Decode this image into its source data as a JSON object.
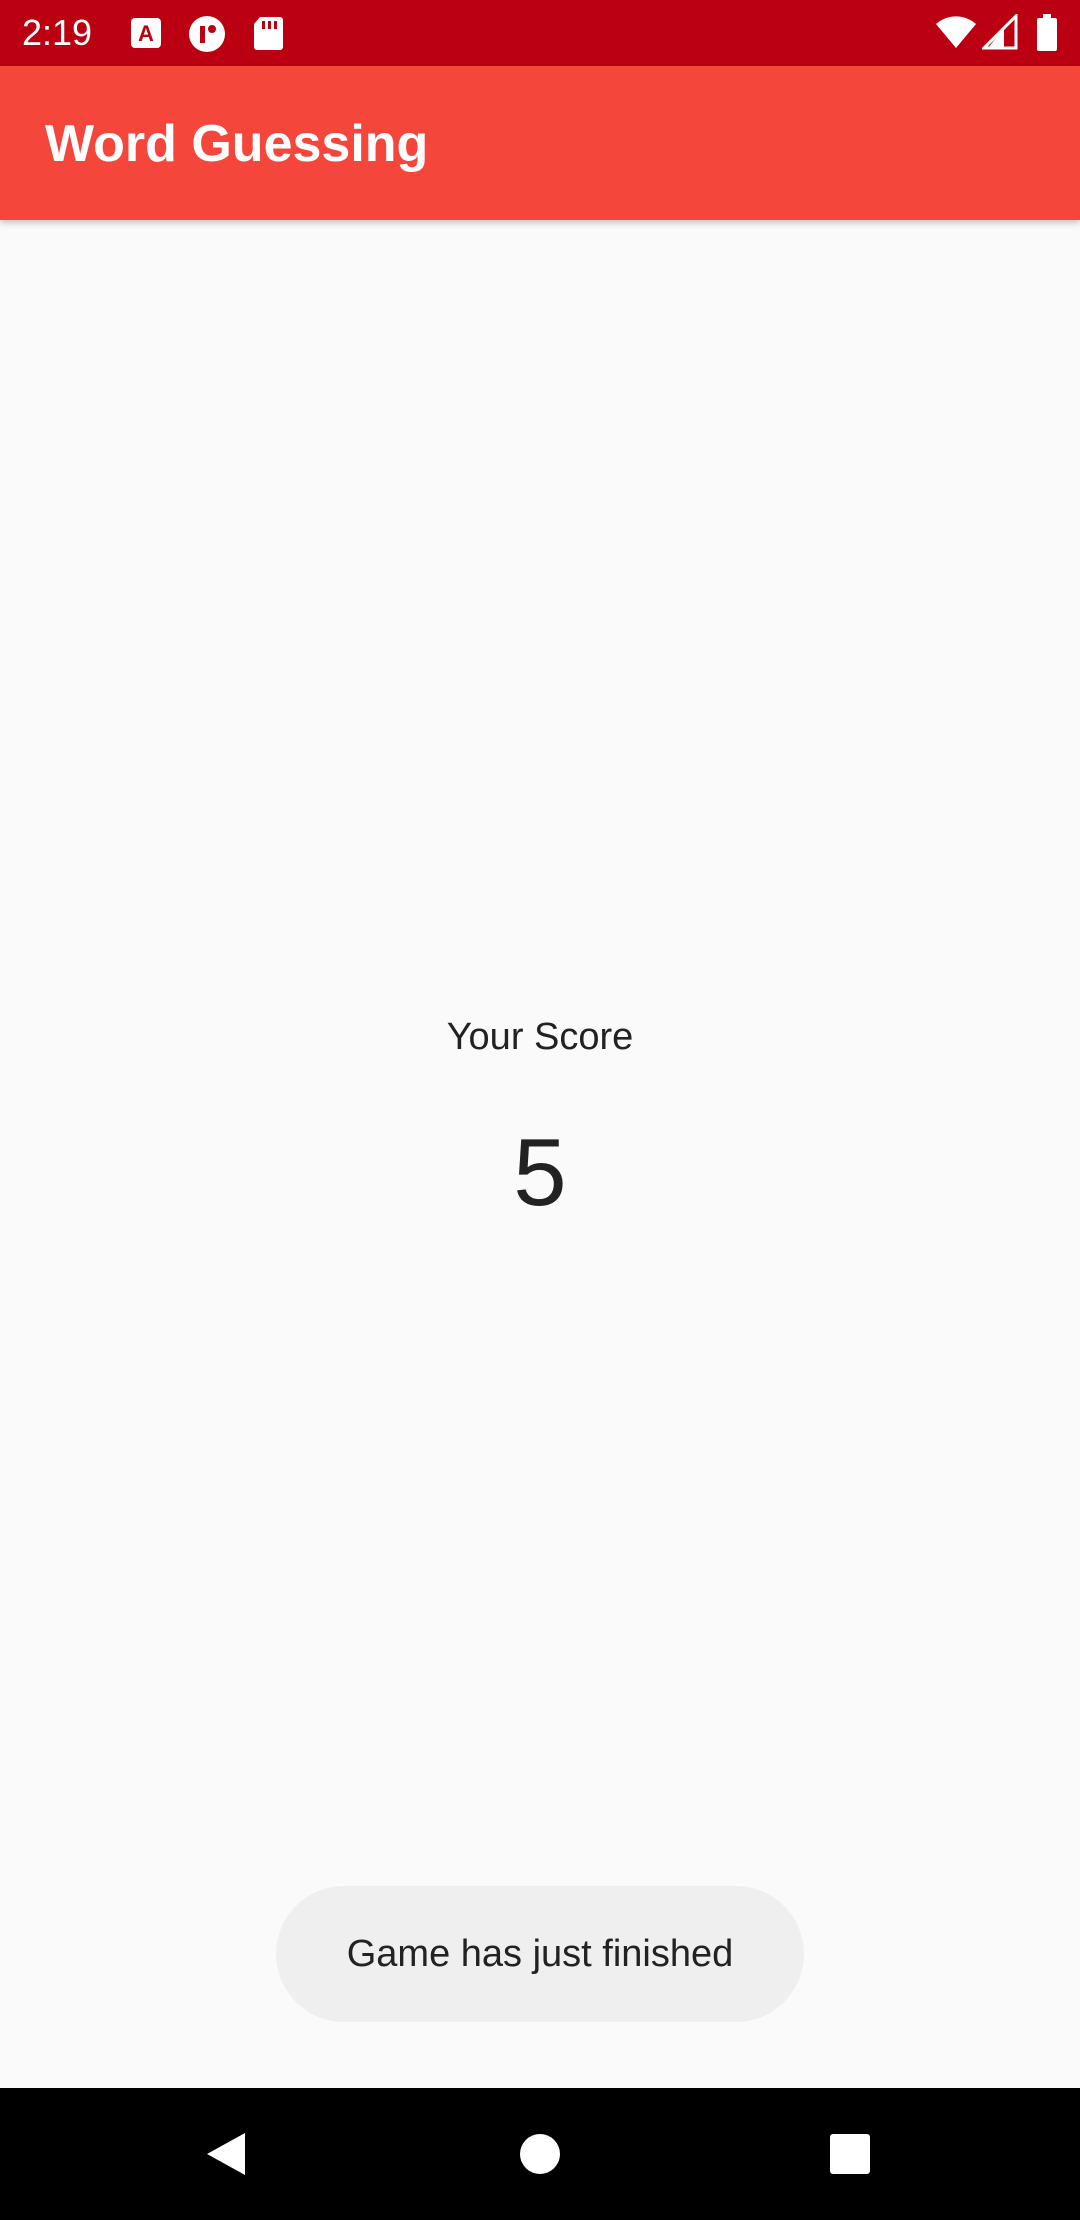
{
  "status_bar": {
    "time": "2:19",
    "background_color": "#ba0011",
    "notification_icons": [
      "a-letter-icon",
      "circle-app-icon",
      "sd-card-icon"
    ],
    "system_icons": [
      "wifi-icon",
      "signal-icon",
      "battery-icon"
    ]
  },
  "app_bar": {
    "title": "Word Guessing",
    "background_color": "#f5463b"
  },
  "score": {
    "label": "Your Score",
    "value": "5"
  },
  "toast": {
    "message": "Game has just finished"
  },
  "nav_bar": {
    "buttons": [
      "back-icon",
      "home-icon",
      "recents-icon"
    ]
  }
}
